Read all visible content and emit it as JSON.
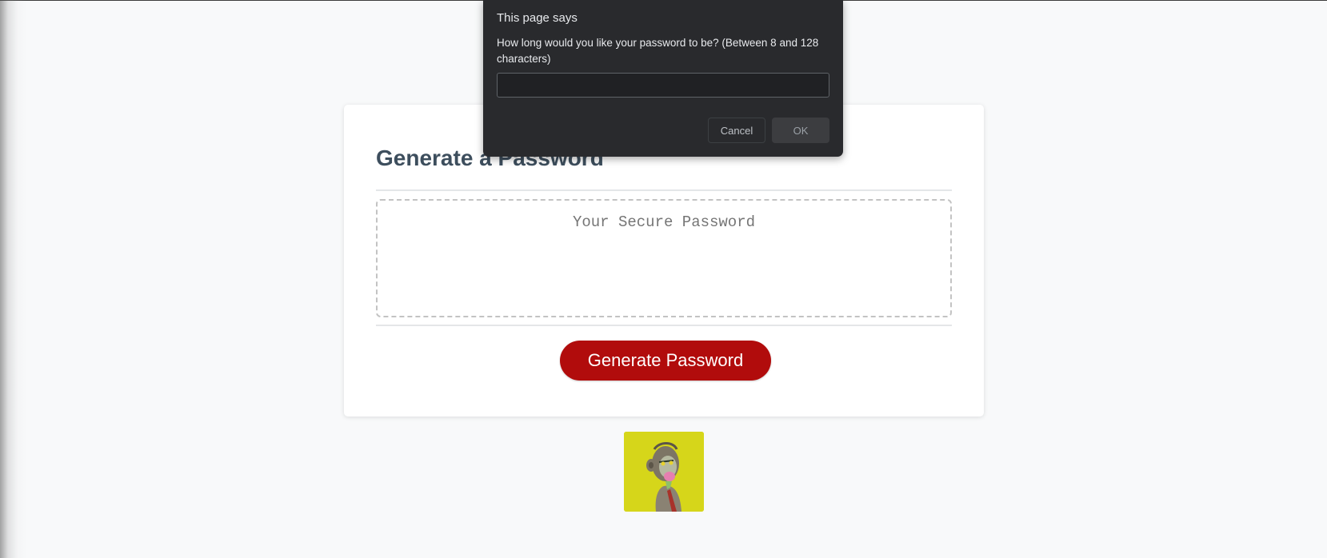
{
  "colors": {
    "page_background": "#f8f9fa",
    "card_title": "#3d4e5d",
    "generate_button": "#b10c0c",
    "dialog_background": "#292a2d",
    "avatar_background": "#d6d61a"
  },
  "dialog": {
    "title": "This page says",
    "message": "How long would you like your password to be? (Between 8 and 128 characters)",
    "input_value": "",
    "cancel_label": "Cancel",
    "ok_label": "OK"
  },
  "card": {
    "title": "Generate a Password",
    "password_placeholder": "Your Secure Password",
    "generate_label": "Generate Password"
  },
  "avatar": {
    "icon": "ape-avatar-icon"
  }
}
